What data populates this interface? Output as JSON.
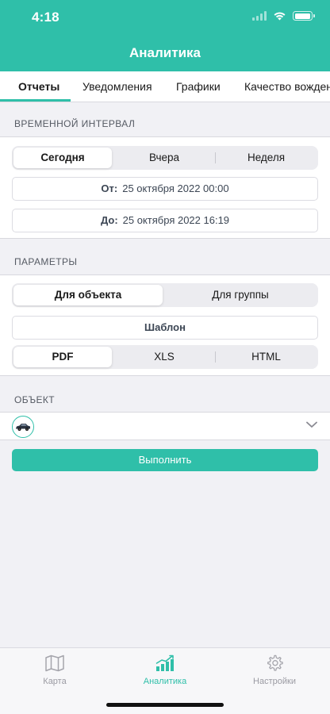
{
  "status_bar": {
    "time": "4:18",
    "battery_level": 0.95
  },
  "header": {
    "title": "Аналитика"
  },
  "tabs": [
    {
      "label": "Отчеты",
      "active": true
    },
    {
      "label": "Уведомления",
      "active": false
    },
    {
      "label": "Графики",
      "active": false
    },
    {
      "label": "Качество вожден",
      "active": false
    }
  ],
  "time_interval": {
    "header": "ВРЕМЕННОЙ ИНТЕРВАЛ",
    "periods": [
      {
        "label": "Сегодня",
        "selected": true
      },
      {
        "label": "Вчера",
        "selected": false
      },
      {
        "label": "Неделя",
        "selected": false
      }
    ],
    "from": {
      "label": "От:",
      "value": "25 октября 2022 00:00"
    },
    "to": {
      "label": "До:",
      "value": "25 октября 2022 16:19"
    }
  },
  "parameters": {
    "header": "ПАРАМЕТРЫ",
    "targets": [
      {
        "label": "Для объекта",
        "selected": true
      },
      {
        "label": "Для группы",
        "selected": false
      }
    ],
    "template_label": "Шаблон",
    "formats": [
      {
        "label": "PDF",
        "selected": true
      },
      {
        "label": "XLS",
        "selected": false
      },
      {
        "label": "HTML",
        "selected": false
      }
    ]
  },
  "object": {
    "header": "ОБЪЕКТ",
    "icon": "car-icon"
  },
  "run_button": {
    "label": "Выполнить"
  },
  "bottom_tabs": [
    {
      "label": "Карта",
      "icon": "map-icon",
      "active": false
    },
    {
      "label": "Аналитика",
      "icon": "analytics-icon",
      "active": true
    },
    {
      "label": "Настройки",
      "icon": "gear-icon",
      "active": false
    }
  ],
  "colors": {
    "accent": "#2fbfa9",
    "background": "#f1f1f5",
    "inactive": "#9a9aa2"
  }
}
